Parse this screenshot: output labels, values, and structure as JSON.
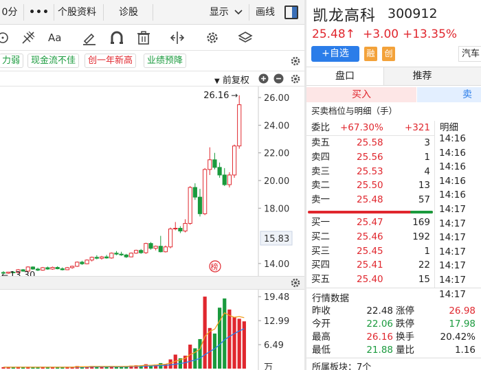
{
  "topbar": {
    "period": "0分",
    "more": "•••",
    "profile": "个股资料",
    "diagnose": "诊股",
    "display": "显示",
    "draw": "画线"
  },
  "tags": [
    {
      "text": "力弱",
      "color": "green"
    },
    {
      "text": "现金流不佳",
      "color": "green"
    },
    {
      "text": "创一年新高",
      "color": "red"
    },
    {
      "text": "业绩预降",
      "color": "green"
    }
  ],
  "chart_header": {
    "adjust": "前复权"
  },
  "kline": {
    "high_label": "26.16",
    "low_label": "13.30",
    "current_price_label": "15.83",
    "badge": "榜",
    "y_ticks": [
      "26.00",
      "24.00",
      "22.00",
      "20.00",
      "18.00",
      "14.00"
    ]
  },
  "volume": {
    "y_ticks": [
      "19.48",
      "12.99",
      "6.49",
      "万"
    ]
  },
  "chart_data": [
    {
      "type": "candlestick",
      "ylim": [
        13.2,
        26.6
      ],
      "y_ticks": [
        14,
        16,
        18,
        20,
        22,
        24,
        26
      ],
      "candles": [
        {
          "o": 13.35,
          "h": 13.45,
          "l": 13.25,
          "c": 13.3
        },
        {
          "o": 13.3,
          "h": 13.4,
          "l": 13.25,
          "c": 13.38
        },
        {
          "o": 13.38,
          "h": 13.45,
          "l": 13.3,
          "c": 13.35
        },
        {
          "o": 13.35,
          "h": 13.6,
          "l": 13.3,
          "c": 13.55
        },
        {
          "o": 13.55,
          "h": 13.6,
          "l": 13.4,
          "c": 13.45
        },
        {
          "o": 13.45,
          "h": 13.8,
          "l": 13.4,
          "c": 13.75
        },
        {
          "o": 13.75,
          "h": 13.8,
          "l": 13.55,
          "c": 13.6
        },
        {
          "o": 13.6,
          "h": 13.7,
          "l": 13.45,
          "c": 13.52
        },
        {
          "o": 13.52,
          "h": 13.75,
          "l": 13.48,
          "c": 13.7
        },
        {
          "o": 13.7,
          "h": 13.78,
          "l": 13.55,
          "c": 13.6
        },
        {
          "o": 13.6,
          "h": 13.78,
          "l": 13.55,
          "c": 13.72
        },
        {
          "o": 13.72,
          "h": 13.8,
          "l": 13.58,
          "c": 13.62
        },
        {
          "o": 13.62,
          "h": 13.72,
          "l": 13.5,
          "c": 13.55
        },
        {
          "o": 13.55,
          "h": 13.75,
          "l": 13.52,
          "c": 13.7
        },
        {
          "o": 13.7,
          "h": 13.85,
          "l": 13.62,
          "c": 13.8
        },
        {
          "o": 13.8,
          "h": 14.15,
          "l": 13.75,
          "c": 14.1
        },
        {
          "o": 14.1,
          "h": 14.2,
          "l": 13.9,
          "c": 13.98
        },
        {
          "o": 13.98,
          "h": 14.3,
          "l": 13.95,
          "c": 14.25
        },
        {
          "o": 14.25,
          "h": 14.5,
          "l": 14.15,
          "c": 14.45
        },
        {
          "o": 14.45,
          "h": 14.6,
          "l": 14.3,
          "c": 14.38
        },
        {
          "o": 14.38,
          "h": 14.55,
          "l": 14.28,
          "c": 14.48
        },
        {
          "o": 14.48,
          "h": 14.62,
          "l": 14.35,
          "c": 14.4
        },
        {
          "o": 14.4,
          "h": 14.8,
          "l": 14.35,
          "c": 14.75
        },
        {
          "o": 14.75,
          "h": 14.9,
          "l": 14.6,
          "c": 14.68
        },
        {
          "o": 14.68,
          "h": 14.85,
          "l": 14.55,
          "c": 14.62
        },
        {
          "o": 14.62,
          "h": 14.7,
          "l": 14.4,
          "c": 14.48
        },
        {
          "o": 14.48,
          "h": 14.8,
          "l": 14.45,
          "c": 14.75
        },
        {
          "o": 14.75,
          "h": 15.0,
          "l": 14.7,
          "c": 14.95
        },
        {
          "o": 14.95,
          "h": 15.05,
          "l": 14.7,
          "c": 14.78
        },
        {
          "o": 14.78,
          "h": 15.5,
          "l": 14.7,
          "c": 15.45
        },
        {
          "o": 15.45,
          "h": 15.55,
          "l": 15.0,
          "c": 15.1
        },
        {
          "o": 15.1,
          "h": 15.3,
          "l": 14.95,
          "c": 15.25
        },
        {
          "o": 15.25,
          "h": 16.0,
          "l": 14.8,
          "c": 14.85
        },
        {
          "o": 14.85,
          "h": 15.3,
          "l": 14.8,
          "c": 15.2
        },
        {
          "o": 15.2,
          "h": 16.6,
          "l": 15.1,
          "c": 16.5
        },
        {
          "o": 16.5,
          "h": 17.0,
          "l": 16.4,
          "c": 16.55
        },
        {
          "o": 16.55,
          "h": 16.7,
          "l": 16.2,
          "c": 16.35
        },
        {
          "o": 16.35,
          "h": 17.2,
          "l": 16.25,
          "c": 16.9
        },
        {
          "o": 16.9,
          "h": 19.6,
          "l": 16.8,
          "c": 19.5
        },
        {
          "o": 19.5,
          "h": 19.8,
          "l": 18.6,
          "c": 18.8
        },
        {
          "o": 18.8,
          "h": 19.4,
          "l": 17.4,
          "c": 17.6
        },
        {
          "o": 17.6,
          "h": 20.9,
          "l": 17.5,
          "c": 20.8
        },
        {
          "o": 20.8,
          "h": 22.4,
          "l": 20.4,
          "c": 21.5
        },
        {
          "o": 21.5,
          "h": 22.0,
          "l": 20.8,
          "c": 20.95
        },
        {
          "o": 20.95,
          "h": 21.3,
          "l": 20.2,
          "c": 20.4
        },
        {
          "o": 20.4,
          "h": 20.9,
          "l": 19.6,
          "c": 19.7
        },
        {
          "o": 19.7,
          "h": 20.6,
          "l": 19.5,
          "c": 20.4
        },
        {
          "o": 20.4,
          "h": 22.6,
          "l": 20.2,
          "c": 22.5
        },
        {
          "o": 22.5,
          "h": 26.16,
          "l": 22.3,
          "c": 25.48
        }
      ]
    },
    {
      "type": "bar",
      "ylim": [
        0,
        21
      ],
      "y_ticks": [
        6.49,
        12.99,
        19.48
      ],
      "values": [
        0.4,
        0.4,
        0.3,
        0.5,
        0.4,
        0.5,
        0.4,
        0.4,
        0.5,
        0.4,
        0.4,
        0.4,
        0.4,
        0.5,
        0.5,
        0.7,
        0.5,
        0.6,
        0.7,
        0.5,
        0.6,
        0.5,
        0.7,
        0.6,
        0.6,
        0.7,
        0.8,
        0.9,
        0.8,
        1.2,
        1.0,
        1.1,
        1.5,
        1.3,
        2.5,
        3.8,
        2.8,
        3.5,
        6.5,
        5.5,
        8.0,
        19.5,
        11.0,
        9.5,
        16.5,
        19.0,
        16.0,
        14.0,
        13.5,
        12.8
      ],
      "ma_short": [
        0.4,
        0.4,
        0.4,
        0.4,
        0.4,
        0.4,
        0.4,
        0.4,
        0.4,
        0.4,
        0.4,
        0.4,
        0.4,
        0.4,
        0.4,
        0.5,
        0.5,
        0.5,
        0.6,
        0.6,
        0.6,
        0.6,
        0.6,
        0.6,
        0.6,
        0.6,
        0.7,
        0.7,
        0.8,
        0.9,
        0.9,
        1.0,
        1.1,
        1.2,
        1.5,
        2.0,
        2.4,
        2.8,
        3.8,
        4.4,
        5.3,
        8.7,
        10.1,
        10.7,
        12.9,
        15.1,
        14.4,
        13.9,
        14.1,
        13.8
      ],
      "ma_long": [
        0.4,
        0.4,
        0.4,
        0.4,
        0.4,
        0.4,
        0.4,
        0.4,
        0.4,
        0.4,
        0.4,
        0.4,
        0.4,
        0.4,
        0.4,
        0.4,
        0.4,
        0.4,
        0.5,
        0.5,
        0.5,
        0.5,
        0.5,
        0.5,
        0.5,
        0.5,
        0.6,
        0.6,
        0.6,
        0.7,
        0.7,
        0.8,
        0.8,
        0.9,
        1.0,
        1.2,
        1.4,
        1.6,
        2.0,
        2.3,
        2.8,
        3.8,
        4.6,
        5.4,
        6.5,
        7.8,
        8.7,
        9.5,
        10.2,
        10.8
      ],
      "colors": [
        "up",
        "up",
        "down",
        "up",
        "down",
        "up",
        "down",
        "down",
        "up",
        "down",
        "up",
        "down",
        "down",
        "up",
        "up",
        "up",
        "down",
        "up",
        "up",
        "down",
        "up",
        "down",
        "up",
        "down",
        "down",
        "down",
        "up",
        "up",
        "down",
        "up",
        "down",
        "up",
        "down",
        "up",
        "up",
        "up",
        "down",
        "up",
        "up",
        "down",
        "down",
        "up",
        "up",
        "down",
        "down",
        "down",
        "up",
        "up",
        "up",
        "up"
      ]
    }
  ],
  "stock": {
    "name": "凯龙高科",
    "code": "300912",
    "price": "25.48↑",
    "change": "+3.00",
    "pct": "+13.35%",
    "add_watch": "+自选",
    "badge_rong": "融",
    "badge_chuang": "创",
    "sector": "汽车"
  },
  "tabs": {
    "handicap": "盘口",
    "recommend": "推荐"
  },
  "trade": {
    "buy": "买入",
    "sell": "卖出"
  },
  "orderbook": {
    "title": "买卖档位与明细（手）",
    "ratio_label": "委比",
    "ratio_value": "+67.30%",
    "ratio_diff": "+321",
    "detail_label": "明细",
    "asks": [
      {
        "label": "卖五",
        "price": "25.58",
        "vol": "3"
      },
      {
        "label": "卖四",
        "price": "25.56",
        "vol": "1"
      },
      {
        "label": "卖三",
        "price": "25.53",
        "vol": "4"
      },
      {
        "label": "卖二",
        "price": "25.50",
        "vol": "13"
      },
      {
        "label": "卖一",
        "price": "25.48",
        "vol": "57"
      }
    ],
    "bids": [
      {
        "label": "买一",
        "price": "25.47",
        "vol": "169"
      },
      {
        "label": "买二",
        "price": "25.46",
        "vol": "192"
      },
      {
        "label": "买三",
        "price": "25.45",
        "vol": "1"
      },
      {
        "label": "买四",
        "price": "25.41",
        "vol": "22"
      },
      {
        "label": "买五",
        "price": "25.40",
        "vol": "15"
      }
    ],
    "times": [
      "14:16",
      "14:16",
      "14:16",
      "14:16",
      "14:16",
      "14:17",
      "14:17",
      "14:17",
      "14:17",
      "14:17",
      "14:17",
      "14:17"
    ],
    "ratio_bar": {
      "ask_fraction": 0.82
    }
  },
  "quote": {
    "title": "行情数据",
    "rows": [
      {
        "l1": "昨收",
        "v1": "22.48",
        "c1": "#222",
        "l2": "涨停",
        "v2": "26.98",
        "c2": "#e0272e"
      },
      {
        "l1": "今开",
        "v1": "22.06",
        "c1": "#1a9a3d",
        "l2": "跌停",
        "v2": "17.98",
        "c2": "#1a9a3d"
      },
      {
        "l1": "最高",
        "v1": "26.16",
        "c1": "#e0272e",
        "l2": "换手",
        "v2": "20.42%",
        "c2": "#222"
      },
      {
        "l1": "最低",
        "v1": "21.88",
        "c1": "#1a9a3d",
        "l2": "量比",
        "v2": "1.16",
        "c2": "#222"
      }
    ],
    "sector_label": "所属板块：7个"
  },
  "colors": {
    "up": "#e0272e",
    "down": "#1a9a3d",
    "blue": "#2b7de9"
  }
}
